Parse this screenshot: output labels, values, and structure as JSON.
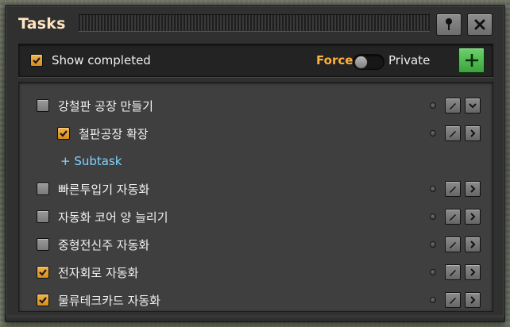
{
  "window": {
    "title": "Tasks"
  },
  "titlebar": {
    "pin_icon": "pin-icon",
    "close_icon": "close-icon"
  },
  "toolbar": {
    "show_completed_label": "Show completed",
    "show_completed_checked": true,
    "force_label": "Force",
    "private_label": "Private",
    "toggle_state": "Force",
    "add_icon": "plus-icon"
  },
  "tasks": [
    {
      "label": "강철판 공장 만들기",
      "checked": false,
      "level": 0,
      "expanded": true
    },
    {
      "label": "철판공장 확장",
      "checked": true,
      "level": 1,
      "expanded": false
    },
    {
      "label": "빠른투입기 자동화",
      "checked": false,
      "level": 0,
      "expanded": false
    },
    {
      "label": "자동화 코어 양 늘리기",
      "checked": false,
      "level": 0,
      "expanded": false
    },
    {
      "label": "중형전신주 자동화",
      "checked": false,
      "level": 0,
      "expanded": false
    },
    {
      "label": "전자회로 자동화",
      "checked": true,
      "level": 0,
      "expanded": false
    },
    {
      "label": "물류테크카드 자동화",
      "checked": true,
      "level": 0,
      "expanded": false
    }
  ],
  "subtask_link": "+ Subtask",
  "colors": {
    "panel_bg": "#313031",
    "title_text": "#ffe6c0",
    "force_accent": "#ffb23a",
    "checkbox_on": "#e8a030",
    "add_button": "#4fb84f",
    "link": "#7fd4ff"
  }
}
